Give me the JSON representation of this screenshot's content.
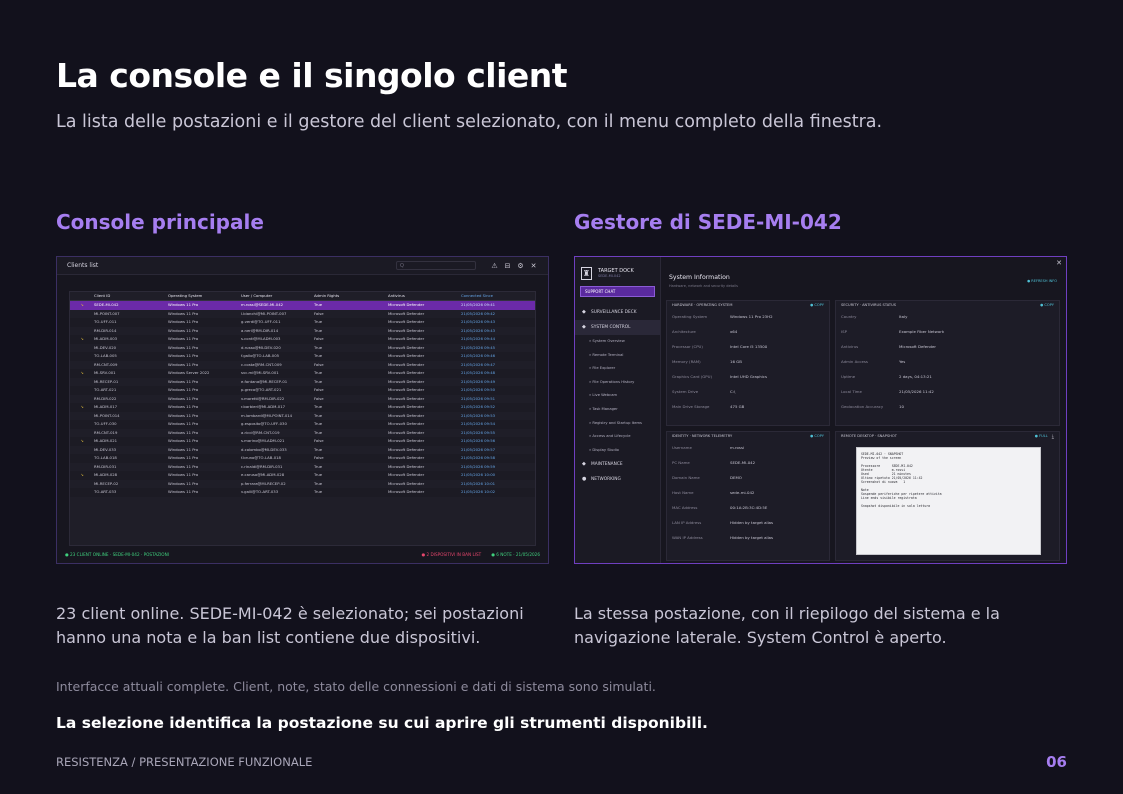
{
  "header": {
    "title": "La console e il singolo client",
    "subtitle": "La lista delle postazioni e il gestore del client selezionato, con il menu completo della finestra."
  },
  "left": {
    "heading": "Console principale",
    "caption": "23 client online. SEDE-MI-042 è selezionato; sei postazioni hanno una nota e la ban list contiene due dispositivi."
  },
  "right": {
    "heading": "Gestore di SEDE-MI-042",
    "caption": "La stessa postazione, con il riepilogo del sistema e la navigazione laterale. System Control è aperto."
  },
  "console": {
    "window_title": "Clients list",
    "search_placeholder": "Q",
    "columns": [
      "",
      "Client ID",
      "Operating System",
      "User / Computer",
      "Admin Rights",
      "Antivirus",
      "Connected Since"
    ],
    "rows": [
      {
        "note": "↘",
        "id": "SEDE-MI-042",
        "os": "Windows 11 Pro",
        "user": "m.rossi@SEDE-MI-042",
        "admin": "True",
        "av": "Microsoft Defender",
        "since": "21/05/2026 09:41"
      },
      {
        "note": "",
        "id": "MI-POINT-007",
        "os": "Windows 11 Pro",
        "user": "l.bianchi@MI-POINT-007",
        "admin": "False",
        "av": "Microsoft Defender",
        "since": "21/05/2026 09:42"
      },
      {
        "note": "",
        "id": "TO-UFF-011",
        "os": "Windows 11 Pro",
        "user": "g.verdi@TO-UFF-011",
        "admin": "True",
        "av": "Microsoft Defender",
        "since": "21/05/2026 09:43"
      },
      {
        "note": "",
        "id": "RM-DIR-014",
        "os": "Windows 11 Pro",
        "user": "a.neri@RM-DIR-014",
        "admin": "True",
        "av": "Microsoft Defender",
        "since": "21/05/2026 09:43"
      },
      {
        "note": "↘",
        "id": "MI-ADM-003",
        "os": "Windows 11 Pro",
        "user": "s.conti@MI-ADM-003",
        "admin": "False",
        "av": "Microsoft Defender",
        "since": "21/05/2026 09:44"
      },
      {
        "note": "",
        "id": "MI-DEV-020",
        "os": "Windows 11 Pro",
        "user": "d.russo@MI-DEV-020",
        "admin": "True",
        "av": "Microsoft Defender",
        "since": "21/05/2026 09:45"
      },
      {
        "note": "",
        "id": "TO-LAB-005",
        "os": "Windows 11 Pro",
        "user": "f.gallo@TO-LAB-005",
        "admin": "True",
        "av": "Microsoft Defender",
        "since": "21/05/2026 09:46"
      },
      {
        "note": "",
        "id": "RM-CNT-009",
        "os": "Windows 11 Pro",
        "user": "c.costa@RM-CNT-009",
        "admin": "False",
        "av": "Microsoft Defender",
        "since": "21/05/2026 09:47"
      },
      {
        "note": "↘",
        "id": "MI-SRV-001",
        "os": "Windows Server 2022",
        "user": "svc.mi@MI-SRV-001",
        "admin": "True",
        "av": "Microsoft Defender",
        "since": "21/05/2026 09:48"
      },
      {
        "note": "",
        "id": "MI-RECEP-01",
        "os": "Windows 11 Pro",
        "user": "e.fontana@MI-RECEP-01",
        "admin": "True",
        "av": "Microsoft Defender",
        "since": "21/05/2026 09:49"
      },
      {
        "note": "",
        "id": "TO-ART-021",
        "os": "Windows 11 Pro",
        "user": "p.greco@TO-ART-021",
        "admin": "False",
        "av": "Microsoft Defender",
        "since": "21/05/2026 09:50"
      },
      {
        "note": "",
        "id": "RM-DIR-022",
        "os": "Windows 11 Pro",
        "user": "v.moretti@RM-DIR-022",
        "admin": "False",
        "av": "Microsoft Defender",
        "since": "21/05/2026 09:51"
      },
      {
        "note": "↘",
        "id": "MI-ADM-017",
        "os": "Windows 11 Pro",
        "user": "r.barbieri@MI-ADM-017",
        "admin": "True",
        "av": "Microsoft Defender",
        "since": "21/05/2026 09:52"
      },
      {
        "note": "",
        "id": "MI-POINT-014",
        "os": "Windows 11 Pro",
        "user": "m.lombardi@MI-POINT-014",
        "admin": "True",
        "av": "Microsoft Defender",
        "since": "21/05/2026 09:53"
      },
      {
        "note": "",
        "id": "TO-UFF-030",
        "os": "Windows 11 Pro",
        "user": "g.esposito@TO-UFF-030",
        "admin": "True",
        "av": "Microsoft Defender",
        "since": "21/05/2026 09:54"
      },
      {
        "note": "",
        "id": "RM-CNT-019",
        "os": "Windows 11 Pro",
        "user": "a.ricci@RM-CNT-019",
        "admin": "True",
        "av": "Microsoft Defender",
        "since": "21/05/2026 09:55"
      },
      {
        "note": "↘",
        "id": "MI-ADM-021",
        "os": "Windows 11 Pro",
        "user": "s.marino@MI-ADM-021",
        "admin": "False",
        "av": "Microsoft Defender",
        "since": "21/05/2026 09:56"
      },
      {
        "note": "",
        "id": "MI-DEV-033",
        "os": "Windows 11 Pro",
        "user": "d.colombo@MI-DEV-033",
        "admin": "True",
        "av": "Microsoft Defender",
        "since": "21/05/2026 09:57"
      },
      {
        "note": "",
        "id": "TO-LAB-018",
        "os": "Windows 11 Pro",
        "user": "f.bruno@TO-LAB-018",
        "admin": "False",
        "av": "Microsoft Defender",
        "since": "21/05/2026 09:58"
      },
      {
        "note": "",
        "id": "RM-DIR-031",
        "os": "Windows 11 Pro",
        "user": "c.rinaldi@RM-DIR-031",
        "admin": "True",
        "av": "Microsoft Defender",
        "since": "21/05/2026 09:59"
      },
      {
        "note": "↘",
        "id": "MI-ADM-028",
        "os": "Windows 11 Pro",
        "user": "e.caruso@MI-ADM-028",
        "admin": "True",
        "av": "Microsoft Defender",
        "since": "21/05/2026 10:00"
      },
      {
        "note": "",
        "id": "MI-RECEP-02",
        "os": "Windows 11 Pro",
        "user": "p.ferrara@MI-RECEP-02",
        "admin": "True",
        "av": "Microsoft Defender",
        "since": "21/05/2026 10:01"
      },
      {
        "note": "",
        "id": "TO-ART-033",
        "os": "Windows 11 Pro",
        "user": "v.galli@TO-ART-033",
        "admin": "True",
        "av": "Microsoft Defender",
        "since": "21/05/2026 10:02"
      }
    ],
    "status_left": "● 23 CLIENT ONLINE · SEDE-MI-042 · POSTAZIONI",
    "status_mid": "● 2 DISPOSITIVI IN BAN LIST",
    "status_right": "● 6 NOTE · 21/05/2026"
  },
  "manager": {
    "app_name": "TARGET DOCK",
    "client_id": "SEDE-MI-042",
    "support_label": "SUPPORT CHAT",
    "nav": [
      {
        "icon": "◆",
        "label": "SURVEILLANCE DECK",
        "active": false
      },
      {
        "icon": "◆",
        "label": "SYSTEM CONTROL",
        "active": true
      }
    ],
    "subnav": [
      "» System Overview",
      "» Remote Terminal",
      "» File Explorer",
      "» File Operations History",
      "» Live Webcam",
      "» Task Manager",
      "» Registry and Startup Items",
      "» Access and Lifecycle",
      "» Display Studio"
    ],
    "nav_bottom": [
      {
        "icon": "◆",
        "label": "MAINTENANCE"
      },
      {
        "icon": "●",
        "label": "NETWORKING"
      }
    ],
    "title": "System Information",
    "subtitle": "Hardware, network and security details",
    "refresh_label": "● REFRESH INFO",
    "hardware": {
      "title": "HARDWARE · OPERATING SYSTEM",
      "action": "● COPY",
      "rows": [
        {
          "k": "Operating System",
          "v": "Windows 11 Pro 23H2"
        },
        {
          "k": "Architecture",
          "v": "x64"
        },
        {
          "k": "Processor (CPU)",
          "v": "Intel Core i5 13500"
        },
        {
          "k": "Memory (RAM)",
          "v": "16 GB"
        },
        {
          "k": "Graphics Card (GPU)",
          "v": "Intel UHD Graphics"
        },
        {
          "k": "System Drive",
          "v": "C:\\"
        },
        {
          "k": "Main Drive Storage",
          "v": "475 GB"
        }
      ]
    },
    "security": {
      "title": "SECURITY · ANTIVIRUS STATUS",
      "action": "● COPY",
      "rows": [
        {
          "k": "Country",
          "v": "Italy"
        },
        {
          "k": "ISP",
          "v": "Example Fiber Network"
        },
        {
          "k": "Antivirus",
          "v": "Microsoft Defender"
        },
        {
          "k": "Admin Access",
          "v": "Yes"
        },
        {
          "k": "Uptime",
          "v": "2 days, 04:13:21"
        },
        {
          "k": "Local Time",
          "v": "21/05/2026 11:42"
        },
        {
          "k": "Geolocation Accuracy",
          "v": "10"
        }
      ]
    },
    "network": {
      "title": "IDENTITY · NETWORK TELEMETRY",
      "action": "● COPY",
      "rows": [
        {
          "k": "Username",
          "v": "m.rossi"
        },
        {
          "k": "PC Name",
          "v": "SEDE-MI-042"
        },
        {
          "k": "Domain Name",
          "v": "DEMO"
        },
        {
          "k": "Host Name",
          "v": "sede-mi-042"
        },
        {
          "k": "MAC Address",
          "v": "00:1A:2B:3C:4D:5E"
        },
        {
          "k": "LAN IP Address",
          "v": "Hidden by target alias"
        },
        {
          "k": "WAN IP Address",
          "v": "Hidden by target alias"
        }
      ]
    },
    "remote": {
      "title": "REMOTE DESKTOP · SNAPSHOT",
      "action": "● FULL",
      "screen_text": "SEDE-MI-042 · SNAPSHOT\nPreview of the screen\n\nProcessore      SEDE-MI-042\nUtente          m.rossi\nUsed            21 minutes\nUltimo ripetuto 21/05/2026 11:42\nScreenshot di nuova   1\n\nNote\nSospende periferiche per ripetere attivita\nLine ends visibile registrata\n\nSnapshot disponibile in sola lettura"
    }
  },
  "footer": {
    "note": "Interfacce attuali complete. Client, note, stato delle connessioni e dati di sistema sono simulati.",
    "claim": "La selezione identifica la postazione su cui aprire gli strumenti disponibili.",
    "label": "RESISTENZA / PRESENTAZIONE FUNZIONALE",
    "page": "06"
  }
}
